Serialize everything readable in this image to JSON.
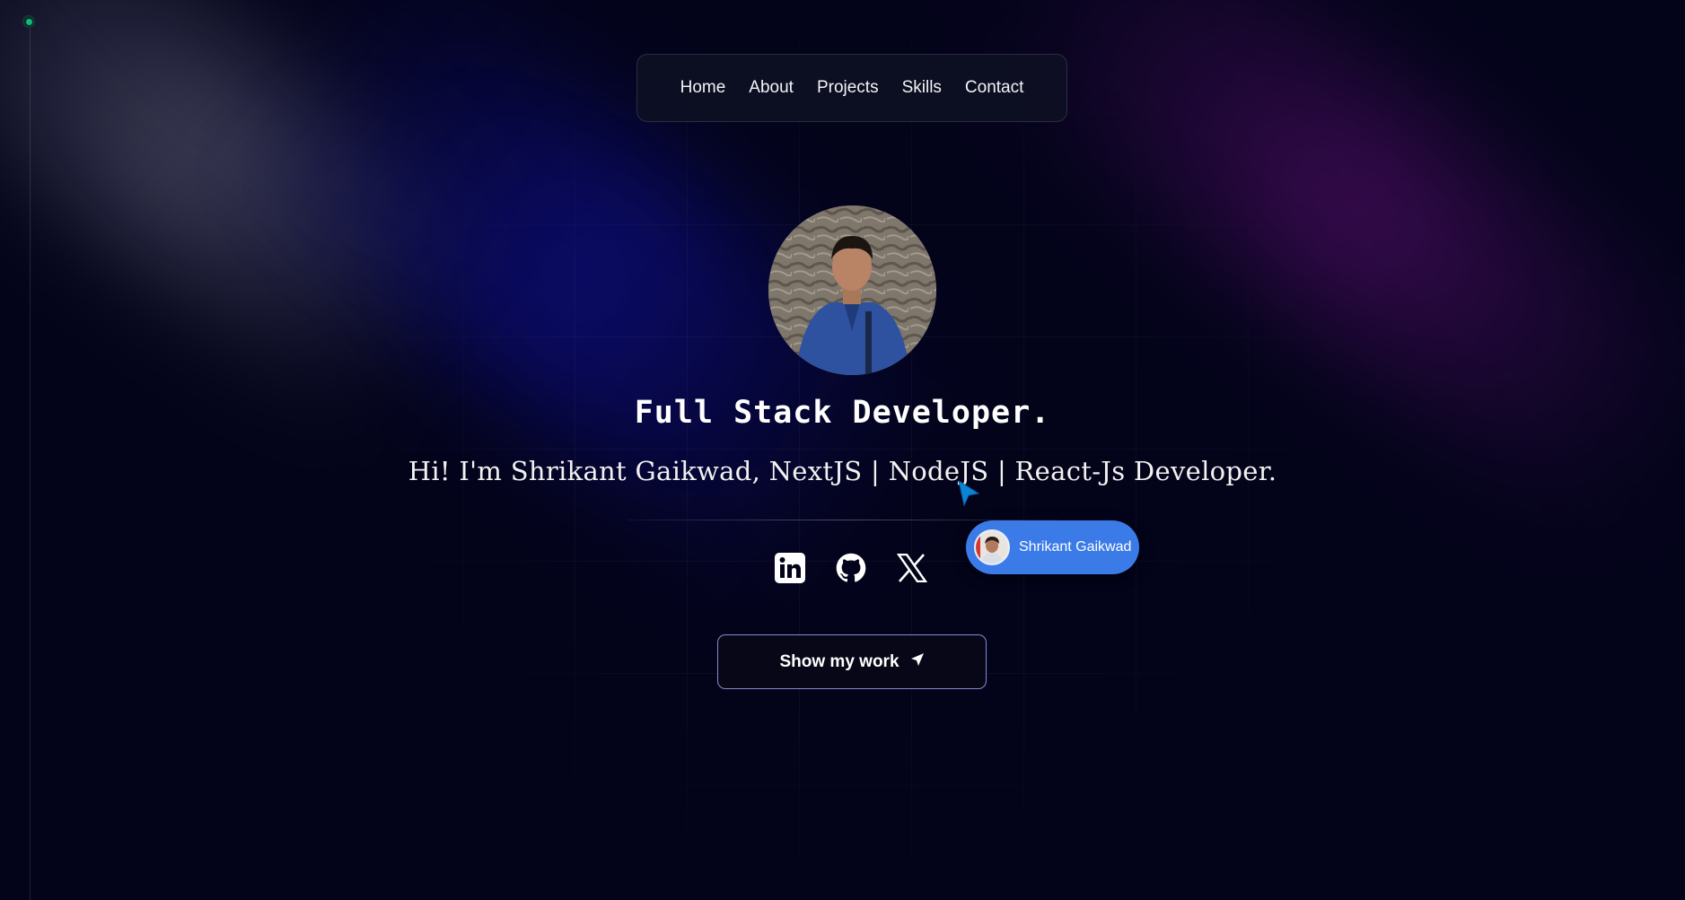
{
  "nav": {
    "items": [
      {
        "label": "Home"
      },
      {
        "label": "About"
      },
      {
        "label": "Projects"
      },
      {
        "label": "Skills"
      },
      {
        "label": "Contact"
      }
    ]
  },
  "hero": {
    "title": "Full Stack Developer.",
    "tagline": "Hi! I'm Shrikant Gaikwad, NextJS | NodeJS | React-Js Developer.",
    "socials": [
      {
        "icon": "linkedin-icon"
      },
      {
        "icon": "github-icon"
      },
      {
        "icon": "x-icon"
      }
    ],
    "cta_label": "Show my work"
  },
  "cursor_badge": {
    "name": "Shrikant Gaikwad"
  },
  "colors": {
    "background": "#03031a",
    "accent_pill": "#3b7be8",
    "status_dot": "#10b981",
    "cta_border": "#a8aaff"
  }
}
